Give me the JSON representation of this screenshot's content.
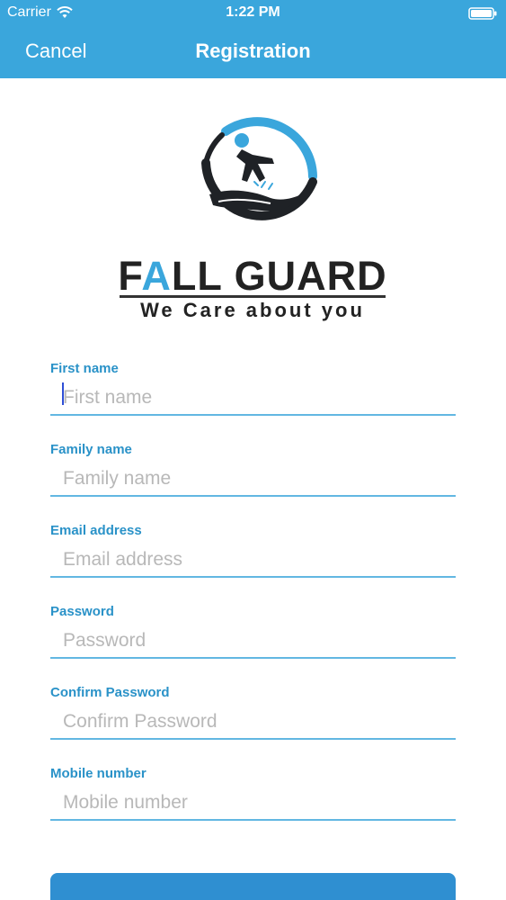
{
  "status_bar": {
    "carrier": "Carrier",
    "time": "1:22 PM"
  },
  "nav": {
    "cancel_label": "Cancel",
    "title": "Registration"
  },
  "logo": {
    "wordmark": "FALL GUARD",
    "tagline": "We Care about you"
  },
  "colors": {
    "header": "#3aa6dc",
    "label": "#2a92c8",
    "underline": "#62b7e2",
    "button": "#2f8fd1"
  },
  "form": {
    "fields": [
      {
        "label": "First name",
        "placeholder": "First name",
        "value": ""
      },
      {
        "label": "Family name",
        "placeholder": "Family name",
        "value": ""
      },
      {
        "label": "Email address",
        "placeholder": "Email address",
        "value": ""
      },
      {
        "label": "Password",
        "placeholder": "Password",
        "value": ""
      },
      {
        "label": "Confirm Password",
        "placeholder": "Confirm Password",
        "value": ""
      },
      {
        "label": "Mobile number",
        "placeholder": "Mobile number",
        "value": ""
      }
    ]
  }
}
